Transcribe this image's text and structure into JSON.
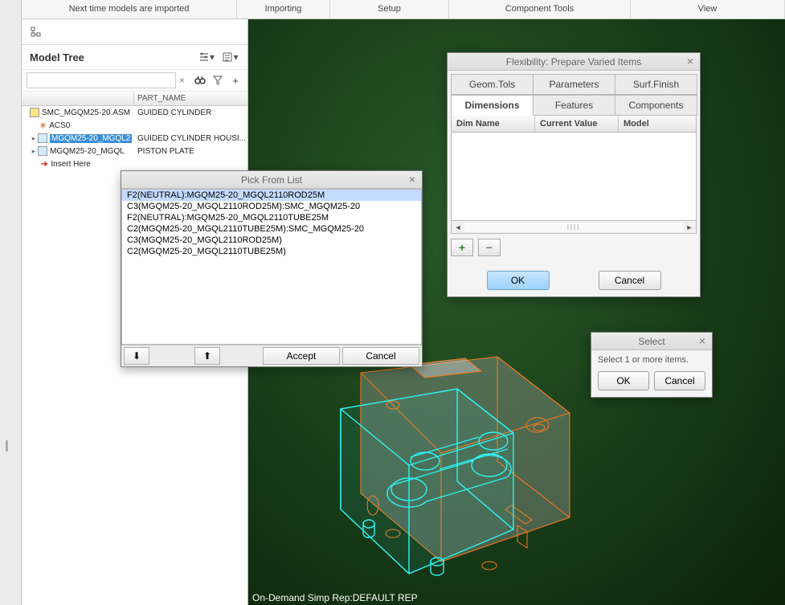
{
  "top_menu": {
    "import_next": "Next time models are imported",
    "importing": "Importing",
    "setup": "Setup",
    "component_tools": "Component Tools",
    "view": "View"
  },
  "tree": {
    "title": "Model Tree",
    "col_part_name": "PART_NAME",
    "rows": {
      "asm": {
        "name": "SMC_MGQM25-20.ASM",
        "pn": "GUIDED CYLINDER"
      },
      "csys": {
        "name": "ACS0"
      },
      "sel": {
        "name": "MGQM25-20_MGQL2",
        "pn": "GUIDED CYLINDER HOUSI..."
      },
      "prt2": {
        "name": "MGQM25-20_MGQL",
        "pn": "PISTON PLATE"
      },
      "insert": "Insert Here"
    }
  },
  "picklist": {
    "title": "Pick From List",
    "items": [
      "F2(NEUTRAL):MGQM25-20_MGQL2110ROD25M",
      "C3(MGQM25-20_MGQL2110ROD25M):SMC_MGQM25-20",
      "F2(NEUTRAL):MGQM25-20_MGQL2110TUBE25M",
      "C2(MGQM25-20_MGQL2110TUBE25M):SMC_MGQM25-20",
      "C3(MGQM25-20_MGQL2110ROD25M)",
      "C2(MGQM25-20_MGQL2110TUBE25M)"
    ],
    "accept": "Accept",
    "cancel": "Cancel"
  },
  "flex": {
    "title": "Flexibility: Prepare Varied Items",
    "tabs_top": {
      "geom": "Geom.Tols",
      "params": "Parameters",
      "surf": "Surf.Finish"
    },
    "tabs_bot": {
      "dims": "Dimensions",
      "feat": "Features",
      "comp": "Components"
    },
    "cols": {
      "dim": "Dim Name",
      "cur": "Current Value",
      "model": "Model"
    },
    "ok": "OK",
    "cancel": "Cancel"
  },
  "select": {
    "title": "Select",
    "msg": "Select 1 or more items.",
    "ok": "OK",
    "cancel": "Cancel"
  },
  "status": "On-Demand Simp Rep:DEFAULT REP"
}
